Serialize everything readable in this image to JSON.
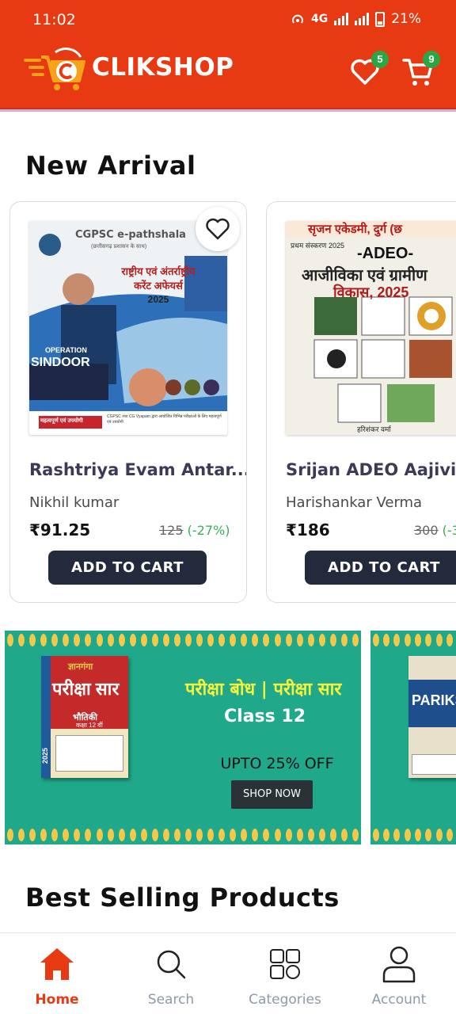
{
  "status_bar": {
    "time": "11:02",
    "network": "4G",
    "battery": "21%"
  },
  "header": {
    "brand": "CLIKSHOP",
    "wishlist_count": "5",
    "cart_count": "9",
    "colors": {
      "header_bg": "#e83a12",
      "badge": "#29a745"
    }
  },
  "new_arrival": {
    "title": "New Arrival",
    "products": [
      {
        "title": "Rashtriya Evam Antar...",
        "author": "Nikhil kumar",
        "price": "₹91.25",
        "mrp": "125",
        "discount": "(-27%)",
        "button": "ADD TO CART",
        "cover": {
          "publisher": "CGPSC e-pathshala",
          "subtitle": "(छत्तीसगढ़ प्रशासन के साथ)",
          "heading_line1": "राष्ट्रीय एवं अंतर्राष्ट्रीय",
          "heading_line2": "करेंट अफेयर्स",
          "year": "2025",
          "tag1": "OPERATION",
          "tag2": "SINDOOR",
          "badge": "महत्वपूर्ण एवं उपयोगी",
          "note": "CGPSC तथा CG Vyapam द्वारा आयोजित विभिन्न परीक्षाओं के लिए महत्वपूर्ण एवं उपयोगी"
        }
      },
      {
        "title": "Srijan ADEO Aajivika",
        "author": "Harishankar Verma",
        "price": "₹186",
        "mrp": "300",
        "discount": "(-3",
        "button": "ADD TO CART",
        "cover": {
          "publisher": "सृजन एकेडमी, दुर्ग (छ",
          "edition": "प्रथम संस्करण 2025",
          "heading_line1": "-ADEO-",
          "heading_line2": "आजीविका एवं ग्रामीण",
          "heading_line3": "विकास, 2025",
          "author": "हरिशंकर वर्मा"
        }
      }
    ]
  },
  "banner": {
    "heading": "परीक्षा बोध | परीक्षा सार",
    "class_label": "Class 12",
    "offer": "UPTO 25% OFF",
    "cta": "SHOP NOW",
    "book": {
      "brand": "ज्ञानगंगा",
      "title": "परीक्षा सार",
      "subject": "भौतिकी",
      "grade": "कक्षा 12 वीं",
      "year": "2025"
    },
    "next_book_title": "PARIKSHA"
  },
  "best_selling": {
    "title": "Best Selling Products"
  },
  "bottom_nav": {
    "items": [
      {
        "label": "Home",
        "icon": "home-icon",
        "active": true
      },
      {
        "label": "Search",
        "icon": "search-icon",
        "active": false
      },
      {
        "label": "Categories",
        "icon": "categories-icon",
        "active": false
      },
      {
        "label": "Account",
        "icon": "account-icon",
        "active": false
      }
    ]
  }
}
